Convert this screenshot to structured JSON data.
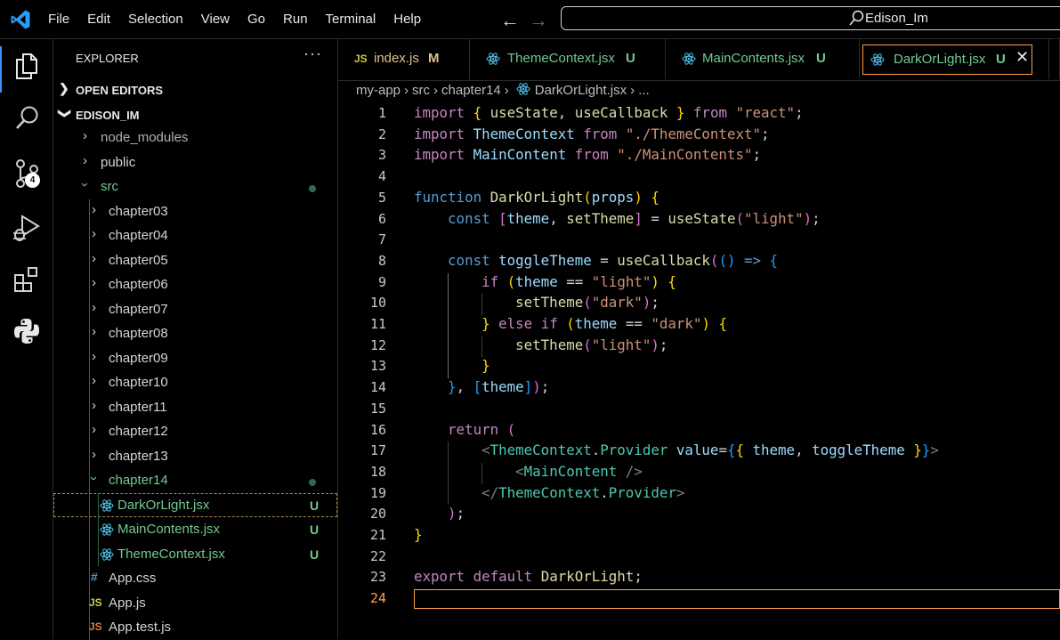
{
  "menu": [
    "File",
    "Edit",
    "Selection",
    "View",
    "Go",
    "Run",
    "Terminal",
    "Help"
  ],
  "search": {
    "label": "Edison_Im"
  },
  "activity": {
    "source_control_badge": "4"
  },
  "sidebar": {
    "title": "EXPLORER",
    "more": "···",
    "open_editors": "OPEN EDITORS",
    "project": "EDISON_IM"
  },
  "tree": [
    {
      "label": "node_modules",
      "type": "folder"
    },
    {
      "label": "public",
      "type": "folder"
    },
    {
      "label": "src",
      "type": "folder-open"
    },
    {
      "label": "chapter03",
      "type": "folder"
    },
    {
      "label": "chapter04",
      "type": "folder"
    },
    {
      "label": "chapter05",
      "type": "folder"
    },
    {
      "label": "chapter06",
      "type": "folder"
    },
    {
      "label": "chapter07",
      "type": "folder"
    },
    {
      "label": "chapter08",
      "type": "folder"
    },
    {
      "label": "chapter09",
      "type": "folder"
    },
    {
      "label": "chapter10",
      "type": "folder"
    },
    {
      "label": "chapter11",
      "type": "folder"
    },
    {
      "label": "chapter12",
      "type": "folder"
    },
    {
      "label": "chapter13",
      "type": "folder"
    },
    {
      "label": "chapter14",
      "type": "folder-open"
    },
    {
      "label": "DarkOrLight.jsx",
      "type": "react",
      "status": "U"
    },
    {
      "label": "MainContents.jsx",
      "type": "react",
      "status": "U"
    },
    {
      "label": "ThemeContext.jsx",
      "type": "react",
      "status": "U"
    },
    {
      "label": "App.css",
      "type": "css"
    },
    {
      "label": "App.js",
      "type": "js"
    },
    {
      "label": "App.test.js",
      "type": "test"
    }
  ],
  "tabs": [
    {
      "label": "index.js",
      "status": "M"
    },
    {
      "label": "ThemeContext.jsx",
      "status": "U"
    },
    {
      "label": "MainContents.jsx",
      "status": "U"
    },
    {
      "label": "DarkOrLight.jsx",
      "status": "U",
      "close": "✕"
    }
  ],
  "breadcrumb": [
    "my-app",
    "src",
    "chapter14",
    "DarkOrLight.jsx",
    "..."
  ],
  "editor": {
    "current_line": 24,
    "line_numbers": [
      "1",
      "2",
      "3",
      "4",
      "5",
      "6",
      "7",
      "8",
      "9",
      "10",
      "11",
      "12",
      "13",
      "14",
      "15",
      "16",
      "17",
      "18",
      "19",
      "20",
      "21",
      "22",
      "23",
      "24"
    ],
    "lines": [
      "import { useState, useCallback } from \"react\";",
      "import ThemeContext from \"./ThemeContext\";",
      "import MainContent from \"./MainContents\";",
      "",
      "function DarkOrLight(props) {",
      "    const [theme, setTheme] = useState(\"light\");",
      "",
      "    const toggleTheme = useCallback(() => {",
      "        if (theme == \"light\") {",
      "            setTheme(\"dark\");",
      "        } else if (theme == \"dark\") {",
      "            setTheme(\"light\");",
      "        }",
      "    }, [theme]);",
      "",
      "    return (",
      "        <ThemeContext.Provider value={{ theme, toggleTheme }}>",
      "            <MainContent />",
      "        </ThemeContext.Provider>",
      "    );",
      "}",
      "",
      "export default DarkOrLight;",
      ""
    ]
  }
}
